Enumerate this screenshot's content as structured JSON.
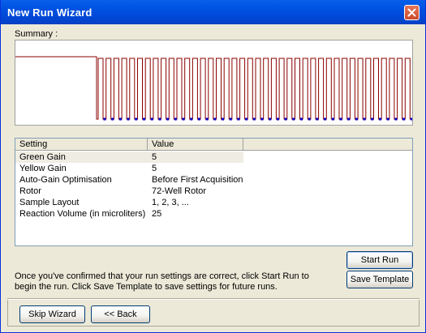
{
  "window": {
    "title": "New Run Wizard"
  },
  "summary": {
    "label": "Summary :"
  },
  "table": {
    "headers": [
      "Setting",
      "Value"
    ],
    "rows": [
      {
        "setting": "Green Gain",
        "value": "5"
      },
      {
        "setting": "Yellow Gain",
        "value": "5"
      },
      {
        "setting": "Auto-Gain Optimisation",
        "value": "Before First Acquisition"
      },
      {
        "setting": "Rotor",
        "value": "72-Well Rotor"
      },
      {
        "setting": "Sample Layout",
        "value": "1, 2, 3, ..."
      },
      {
        "setting": "Reaction Volume (in microliters)",
        "value": "25"
      }
    ]
  },
  "message": "Once you've confirmed that your run settings are correct, click Start Run to begin the run. Click Save Template to save settings for future runs.",
  "buttons": {
    "start_run": "Start Run",
    "save_template": "Save Template",
    "skip_wizard": "Skip Wizard",
    "back": "<< Back"
  },
  "colors": {
    "trace": "#8B0000",
    "markers": "#0000CC"
  }
}
